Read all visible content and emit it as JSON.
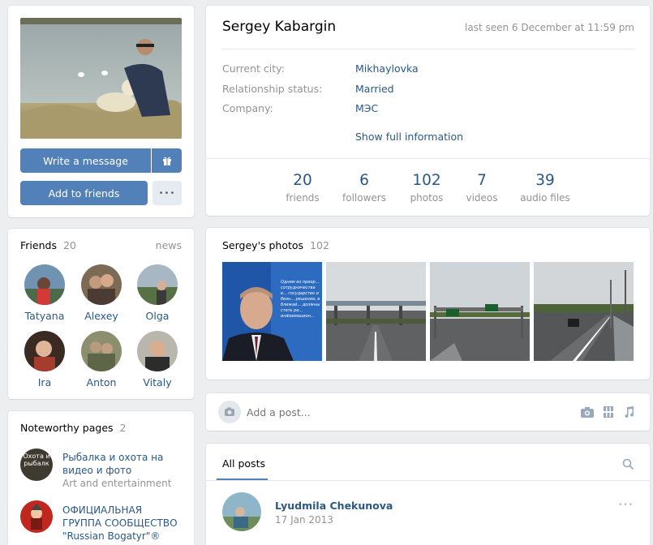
{
  "profile": {
    "name": "Sergey Kabargin",
    "last_seen": "last seen 6 December at 11:59 pm",
    "write_message": "Write a message",
    "add_to_friends": "Add to friends",
    "more_glyph": "•••",
    "gift_icon": "gift-icon",
    "info": [
      {
        "label": "Current city:",
        "value": "Mikhaylovka"
      },
      {
        "label": "Relationship status:",
        "value": "Married"
      },
      {
        "label": "Company:",
        "value": "МЭС"
      }
    ],
    "show_full": "Show full information",
    "counters": [
      {
        "num": "20",
        "label": "friends"
      },
      {
        "num": "6",
        "label": "followers"
      },
      {
        "num": "102",
        "label": "photos"
      },
      {
        "num": "7",
        "label": "videos"
      },
      {
        "num": "39",
        "label": "audio files"
      }
    ]
  },
  "friends": {
    "title": "Friends",
    "count": "20",
    "news": "news",
    "items": [
      {
        "name": "Tatyana"
      },
      {
        "name": "Alexey"
      },
      {
        "name": "Olga"
      },
      {
        "name": "Ira"
      },
      {
        "name": "Anton"
      },
      {
        "name": "Vitaly"
      }
    ]
  },
  "photos": {
    "title": "Sergey's photos",
    "count": "102",
    "thumb1_text": "Одним из приор... сотрудничества в... государство и бизн... решения, в ближай... должны стать ре... информацион..."
  },
  "post_box": {
    "placeholder": "Add a post...",
    "icons": [
      "camera-icon",
      "video-icon",
      "music-icon"
    ]
  },
  "noteworthy": {
    "title": "Noteworthy pages",
    "count": "2",
    "pages": [
      {
        "line1": "Рыбалка и охота на",
        "line2": "видео и фото",
        "sub": "Art and entertainment",
        "avatar_text": "Охота и рыбалк"
      },
      {
        "line1": "ОФИЦИАЛЬНАЯ",
        "line2": "ГРУППА СООБЩЕСТВО",
        "line3": "\"Russian Bogatyr\"®"
      }
    ]
  },
  "posts": {
    "tab": "All posts",
    "author": "Lyudmila Chekunova",
    "date": "17 Jan 2013",
    "more_glyph": "•••"
  },
  "colors": {
    "accent": "#5181b8",
    "link": "#2a5885",
    "bg": "#edeef0"
  }
}
